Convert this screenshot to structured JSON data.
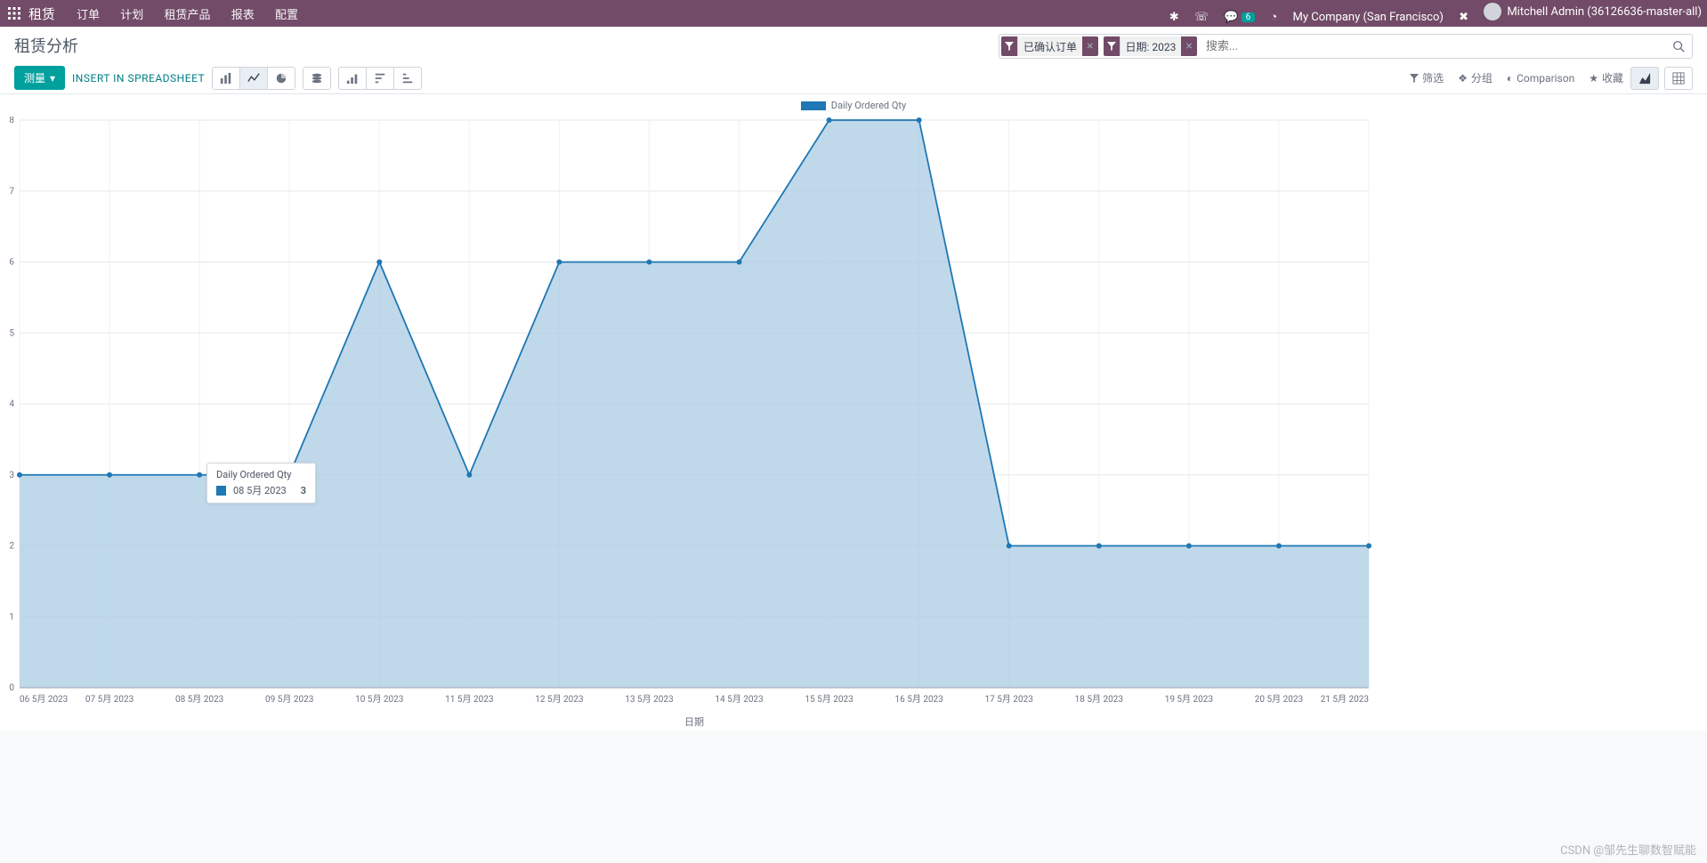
{
  "topbar": {
    "brand": "租赁",
    "nav": [
      "订单",
      "计划",
      "租赁产品",
      "报表",
      "配置"
    ],
    "company": "My Company (San Francisco)",
    "user": "Mitchell Admin (36126636-master-all)",
    "msg_badge": "6"
  },
  "cp": {
    "title": "租赁分析",
    "measure_btn": "测量",
    "insert_btn": "INSERT IN SPREADSHEET",
    "facets": [
      {
        "label": "已确认订单"
      },
      {
        "label": "日期: 2023"
      }
    ],
    "search_placeholder": "搜索...",
    "opts": {
      "filter": "筛选",
      "group": "分组",
      "compare": "Comparison",
      "favorite": "收藏"
    }
  },
  "legend": {
    "series": "Daily Ordered Qty"
  },
  "tooltip": {
    "title": "Daily Ordered Qty",
    "label": "08 5月 2023",
    "value": "3"
  },
  "chart_data": {
    "type": "area",
    "title": "",
    "xlabel": "日期",
    "ylabel": "",
    "ylim": [
      0,
      8
    ],
    "yticks": [
      0,
      1,
      2,
      3,
      4,
      5,
      6,
      7,
      8
    ],
    "categories": [
      "06 5月 2023",
      "07 5月 2023",
      "08 5月 2023",
      "09 5月 2023",
      "10 5月 2023",
      "11 5月 2023",
      "12 5月 2023",
      "13 5月 2023",
      "14 5月 2023",
      "15 5月 2023",
      "16 5月 2023",
      "17 5月 2023",
      "18 5月 2023",
      "19 5月 2023",
      "20 5月 2023",
      "21 5月 2023"
    ],
    "series": [
      {
        "name": "Daily Ordered Qty",
        "values": [
          3,
          3,
          3,
          3,
          6,
          3,
          6,
          6,
          6,
          8,
          8,
          2,
          2,
          2,
          2,
          2
        ]
      }
    ]
  },
  "watermark": "CSDN @邹先生聊数智赋能"
}
